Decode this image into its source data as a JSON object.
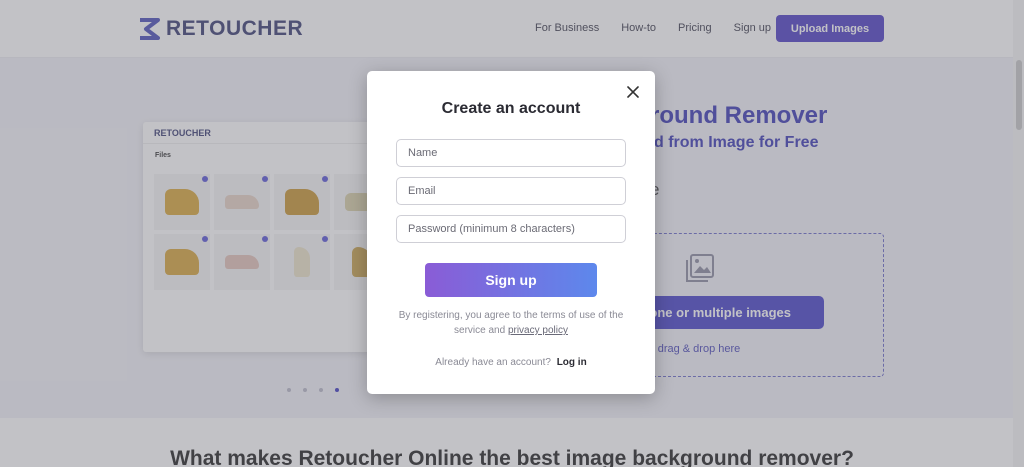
{
  "header": {
    "logo_text": "RETOUCHER",
    "nav": [
      {
        "label": "For Business"
      },
      {
        "label": "How-to"
      },
      {
        "label": "Pricing"
      },
      {
        "label": "Sign up"
      }
    ],
    "upload_label": "Upload Images"
  },
  "hero": {
    "preview": {
      "logo_text": "RETOUCHER",
      "files_label": "Files"
    },
    "title_visible": "round Remover",
    "subtitle_visible": "d from Image for Free",
    "partial_char": "e",
    "dropzone": {
      "button_visible": "one or multiple images",
      "hint_visible": "r drag & drop here"
    },
    "carousel_active_index": 3
  },
  "section_title": "What makes Retoucher Online the best image background remover?",
  "modal": {
    "title": "Create an account",
    "name_placeholder": "Name",
    "email_placeholder": "Email",
    "password_placeholder": "Password (minimum 8 characters)",
    "signup_label": "Sign up",
    "terms_text": "By registering, you agree to the terms of use of the service and",
    "privacy_link": "privacy policy",
    "login_prompt": "Already have an account?",
    "login_link": "Log in"
  },
  "icons": {
    "close": "close-icon",
    "logo": "retoucher-logo-icon",
    "upload": "images-icon"
  },
  "colors": {
    "brand": "#3a3d73",
    "accent": "#4f3fc4",
    "button_gradient_start": "#8a5cd6",
    "button_gradient_end": "#5d88ec"
  }
}
